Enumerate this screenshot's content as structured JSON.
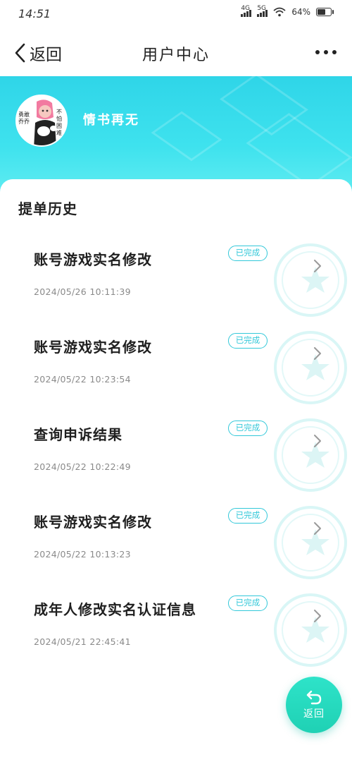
{
  "status_bar": {
    "time": "14:51",
    "net1": "4G",
    "net2": "5G",
    "battery": "64%",
    "battery_level": 0.64
  },
  "nav": {
    "back_label": "返回",
    "title": "用户中心"
  },
  "profile": {
    "username": "情书再无",
    "avatar_text_left": "勇敢乔乔",
    "avatar_text_right": "不怕困难"
  },
  "section_title": "提单历史",
  "records": [
    {
      "title": "账号游戏实名修改",
      "time": "2024/05/26 10:11:39",
      "status": "已完成"
    },
    {
      "title": "账号游戏实名修改",
      "time": "2024/05/22 10:23:54",
      "status": "已完成"
    },
    {
      "title": "查询申诉结果",
      "time": "2024/05/22 10:22:49",
      "status": "已完成"
    },
    {
      "title": "账号游戏实名修改",
      "time": "2024/05/22 10:13:23",
      "status": "已完成"
    },
    {
      "title": "成年人修改实名认证信息",
      "time": "2024/05/21 22:45:41",
      "status": "已完成"
    }
  ],
  "fab": {
    "label": "返回"
  },
  "colors": {
    "accent": "#2fd5e8",
    "badge": "#32c8d9",
    "fab": "#1fd1b4"
  }
}
